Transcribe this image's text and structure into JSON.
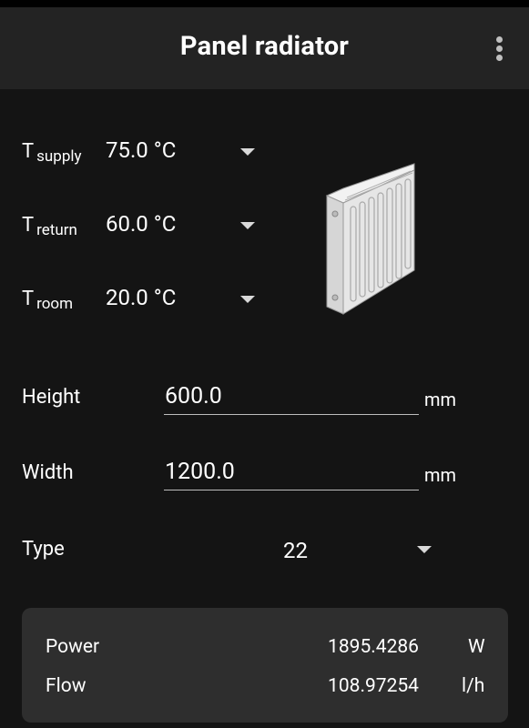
{
  "appbar": {
    "title": "Panel radiator",
    "menu_icon": "more-vert-icon"
  },
  "temperatures": [
    {
      "label": "T",
      "sub": "supply",
      "value": "75.0 °C"
    },
    {
      "label": "T",
      "sub": "return",
      "value": "60.0 °C"
    },
    {
      "label": "T",
      "sub": "room",
      "value": "20.0 °C"
    }
  ],
  "illustration": {
    "icon": "panel-radiator-icon"
  },
  "dimensions": {
    "height": {
      "label": "Height",
      "value": "600.0",
      "unit": "mm"
    },
    "width": {
      "label": "Width",
      "value": "1200.0",
      "unit": "mm"
    }
  },
  "type": {
    "label": "Type",
    "value": "22"
  },
  "results": {
    "power": {
      "label": "Power",
      "value": "1895.4286",
      "unit": "W"
    },
    "flow": {
      "label": "Flow",
      "value": "108.97254",
      "unit": "l/h"
    }
  },
  "colors": {
    "background": "#141414",
    "appbar": "#232323",
    "card": "#2e2e2e",
    "text": "#ffffff"
  }
}
